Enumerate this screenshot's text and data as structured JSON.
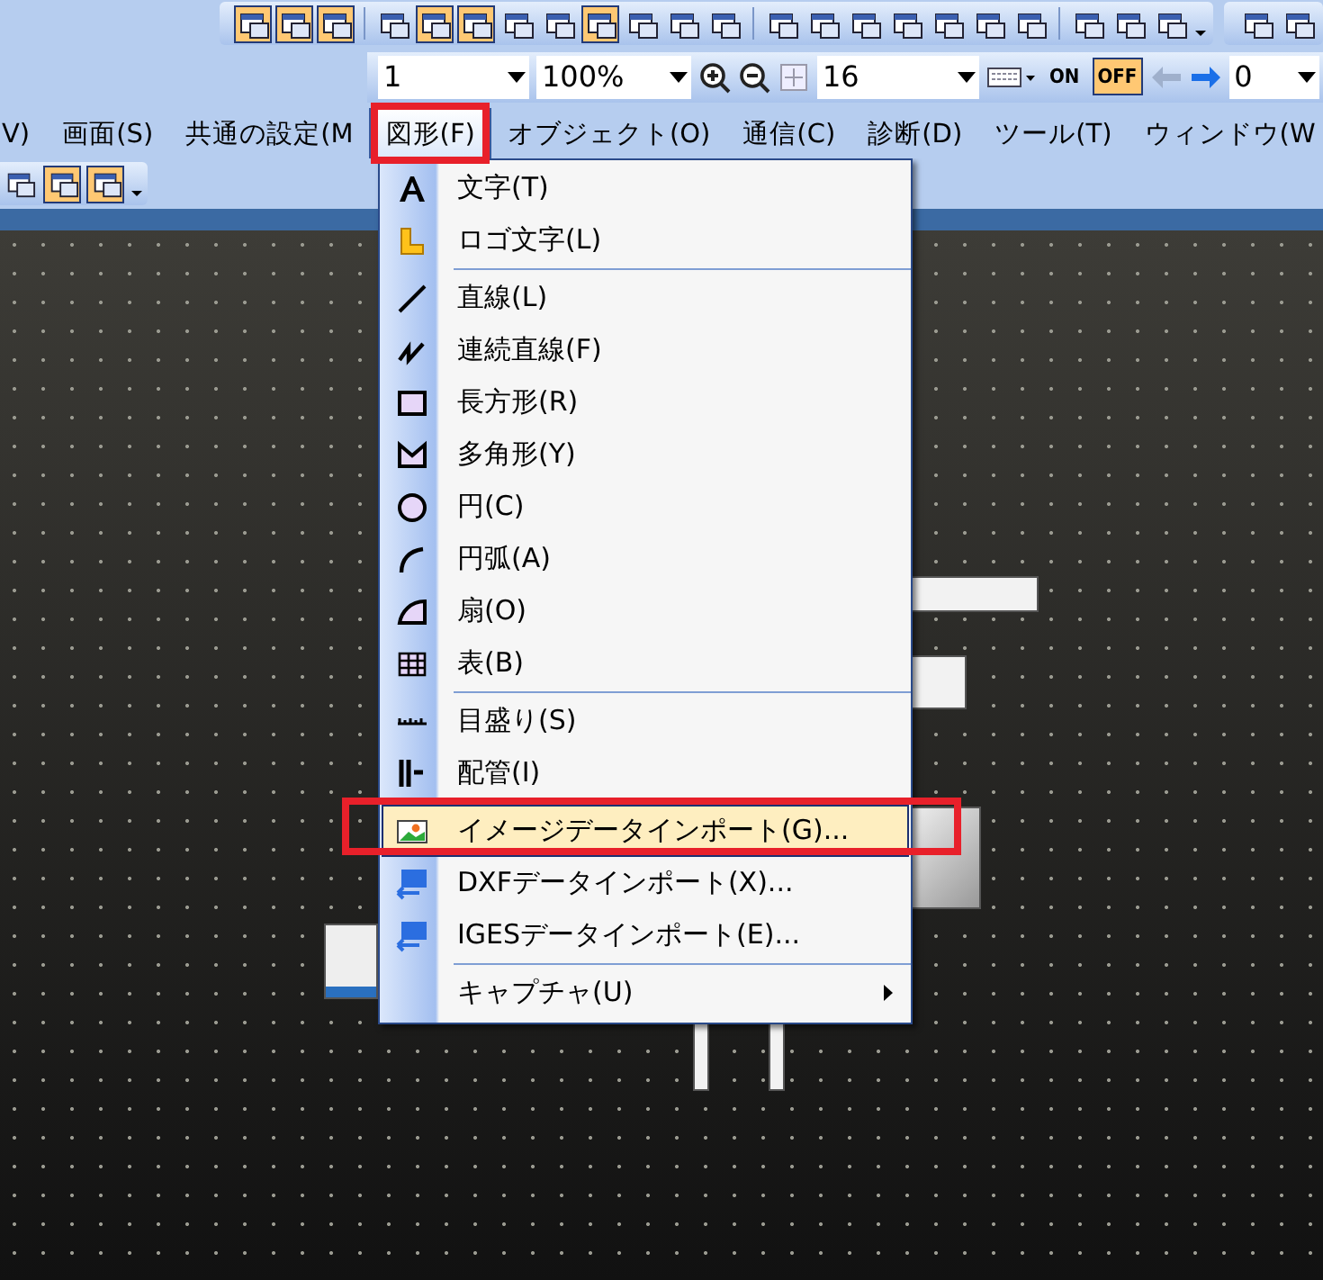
{
  "toolbar_top": {
    "groups": [
      [
        {
          "on": true
        },
        {
          "on": true
        },
        {
          "on": true
        }
      ],
      [
        {
          "on": false
        },
        {
          "on": true
        },
        {
          "on": true
        },
        {
          "on": false
        },
        {
          "on": false
        },
        {
          "on": true
        },
        {
          "on": false
        },
        {
          "on": false
        },
        {
          "on": false
        }
      ],
      [
        {
          "on": false
        },
        {
          "on": false
        },
        {
          "on": false
        },
        {
          "on": false
        },
        {
          "on": false
        },
        {
          "on": false
        },
        {
          "on": false
        }
      ],
      [
        {
          "on": false
        },
        {
          "on": false
        },
        {
          "on": false
        }
      ],
      [
        {
          "on": false
        },
        {
          "on": false
        }
      ]
    ]
  },
  "toolbar_view": {
    "page_field": "1",
    "zoom_field": "100%",
    "grid_field": "16",
    "on_label": "ON",
    "off_label": "OFF",
    "off_selected": true,
    "back_disabled": true,
    "number_field": "0"
  },
  "menu_bar": [
    {
      "label": "V)",
      "selected": false
    },
    {
      "label": "画面(S)",
      "selected": false
    },
    {
      "label": "共通の設定(M",
      "selected": false
    },
    {
      "label": "図形(F)",
      "selected": true
    },
    {
      "label": "オブジェクト(O)",
      "selected": false
    },
    {
      "label": "通信(C)",
      "selected": false
    },
    {
      "label": "診断(D)",
      "selected": false
    },
    {
      "label": "ツール(T)",
      "selected": false
    },
    {
      "label": "ウィンドウ(W",
      "selected": false
    }
  ],
  "toolbar_small": [
    {
      "on": false
    },
    {
      "on": true
    },
    {
      "on": true
    }
  ],
  "menu": [
    {
      "kind": "item",
      "label": "文字(T)",
      "selected": false
    },
    {
      "kind": "item",
      "label": "ロゴ文字(L)",
      "selected": false
    },
    {
      "kind": "separator"
    },
    {
      "kind": "item",
      "label": "直線(L)",
      "selected": false
    },
    {
      "kind": "item",
      "label": "連続直線(F)",
      "selected": false
    },
    {
      "kind": "item",
      "label": "長方形(R)",
      "selected": false
    },
    {
      "kind": "item",
      "label": "多角形(Y)",
      "selected": false
    },
    {
      "kind": "item",
      "label": "円(C)",
      "selected": false
    },
    {
      "kind": "item",
      "label": "円弧(A)",
      "selected": false
    },
    {
      "kind": "item",
      "label": "扇(O)",
      "selected": false
    },
    {
      "kind": "item",
      "label": "表(B)",
      "selected": false
    },
    {
      "kind": "separator"
    },
    {
      "kind": "item",
      "label": "目盛り(S)",
      "selected": false
    },
    {
      "kind": "item",
      "label": "配管(I)",
      "selected": false
    },
    {
      "kind": "separator"
    },
    {
      "kind": "item",
      "label": "イメージデータインポート(G)...",
      "selected": true
    },
    {
      "kind": "item",
      "label": "DXFデータインポート(X)...",
      "selected": false
    },
    {
      "kind": "item",
      "label": "IGESデータインポート(E)...",
      "selected": false
    },
    {
      "kind": "separator"
    },
    {
      "kind": "submenu",
      "label": "キャプチャ(U)",
      "selected": false
    }
  ]
}
